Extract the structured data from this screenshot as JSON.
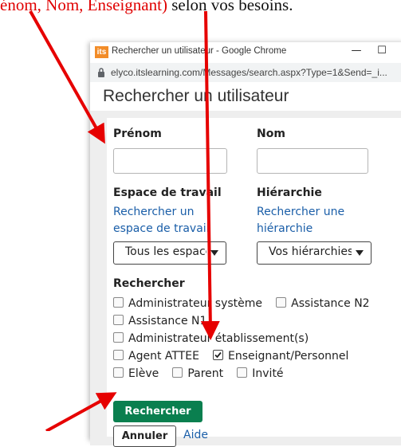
{
  "doc_caption": {
    "red_text": "énom, Nom, Enseignant)",
    "black_text": " selon vos besoins."
  },
  "window": {
    "logo_text": "its",
    "title": "Rechercher un utilisateur - Google Chrome",
    "minimize": "—",
    "maximize": "☐",
    "close": "✕",
    "url": "elyco.itslearning.com/Messages/search.aspx?Type=1&Send=_i..."
  },
  "page": {
    "title": "Rechercher un utilisateur"
  },
  "form": {
    "first_name_label": "Prénom",
    "first_name_value": "",
    "last_name_label": "Nom",
    "last_name_value": "",
    "workspace_label": "Espace de travail",
    "workspace_link_line1": "Rechercher un",
    "workspace_link_line2": "espace de travail",
    "workspace_select_value": "Tous les espaces",
    "hierarchy_label": "Hiérarchie",
    "hierarchy_link_line1": "Rechercher une",
    "hierarchy_link_line2": "hiérarchie",
    "hierarchy_select_value": "Vos hiérarchies",
    "search_section_label": "Rechercher",
    "roles": [
      {
        "label": "Administrateur système",
        "checked": false
      },
      {
        "label": "Assistance N2",
        "checked": false
      },
      {
        "label": "Assistance N1",
        "checked": false
      },
      {
        "label": "Administrateur établissement(s)",
        "checked": false
      },
      {
        "label": "Agent ATTEE",
        "checked": false
      },
      {
        "label": "Enseignant/Personnel",
        "checked": true
      },
      {
        "label": "Elève",
        "checked": false
      },
      {
        "label": "Parent",
        "checked": false
      },
      {
        "label": "Invité",
        "checked": false
      }
    ],
    "search_button": "Rechercher",
    "cancel_button": "Annuler",
    "help_link": "Aide"
  },
  "colors": {
    "annotation_arrow": "#e60000",
    "primary_button": "#0a7f4f",
    "link": "#1a5ea8",
    "caption_red": "#e00000"
  }
}
